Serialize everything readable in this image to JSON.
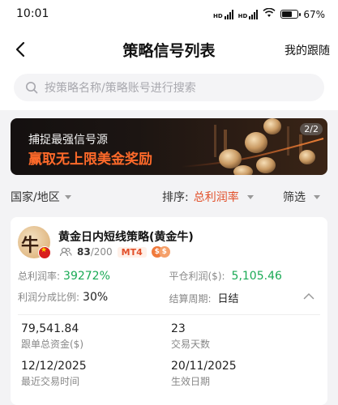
{
  "status_bar": {
    "time": "10:01",
    "network_1": "HD",
    "network_2": "HD",
    "battery": "67%",
    "battery_level": 0.67
  },
  "nav": {
    "title": "策略信号列表",
    "right_link": "我的跟随"
  },
  "search": {
    "placeholder": "按策略名称/策略账号进行搜索"
  },
  "banner": {
    "line1": "捕捉最强信号源",
    "line2": "赢取无上限美金奖励",
    "page_indicator": "2/2"
  },
  "filters": {
    "region": "国家/地区",
    "sort_label": "排序:",
    "sort_value": "总利润率",
    "filter_label": "筛选"
  },
  "strategy_card": {
    "title": "黄金日内短线策略(黄金牛)",
    "avatar_glyph": "牛",
    "followers_current": "83",
    "followers_total": "/200",
    "platform_badge": "MT4",
    "profit_rate_label": "总利润率:",
    "profit_rate_value": "39272%",
    "closed_profit_label": "平仓利润($):",
    "closed_profit_value": "5,105.46",
    "profit_share_label": "利润分成比例:",
    "profit_share_value": "30%",
    "settlement_label": "结算周期:",
    "settlement_value": "日结",
    "follow_funds_value": "79,541.84",
    "follow_funds_label": "跟单总资金($)",
    "trading_days_value": "23",
    "trading_days_label": "交易天数",
    "last_trade_value": "12/12/2025",
    "last_trade_label": "最近交易时间",
    "effective_date_value": "20/11/2025",
    "effective_date_label": "生效日期"
  },
  "colors": {
    "accent": "#e2502a",
    "profit_green": "#1aaa55",
    "banner_orange": "#ff6a2a"
  }
}
